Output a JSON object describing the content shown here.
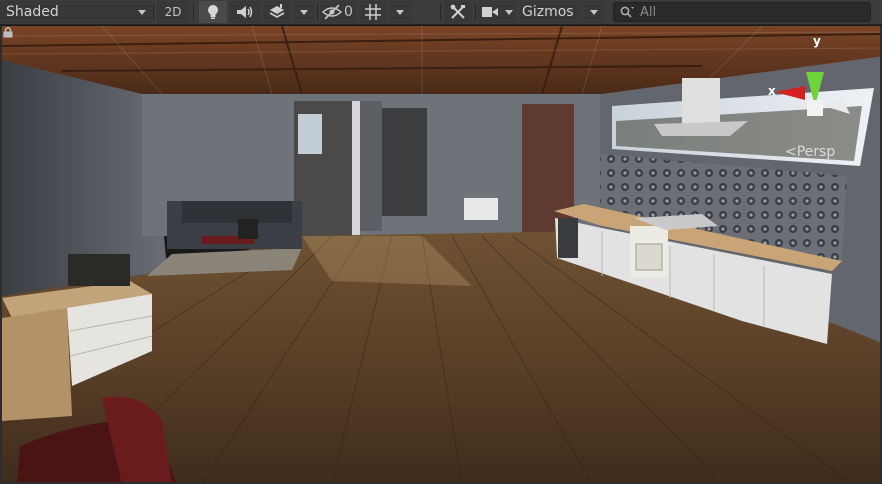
{
  "toolbar": {
    "draw_mode": "Shaded",
    "toggle_2d": "2D",
    "hidden_count": "0",
    "gizmos": "Gizmos",
    "search_placeholder": "All"
  },
  "icons": {
    "lighting": "lightbulb-icon",
    "audio": "speaker-icon",
    "effects": "layers-icon",
    "visibility": "eye-slash-icon",
    "grid": "grid-snap-icon",
    "tools": "tools-icon",
    "camera": "camera-icon",
    "search": "search-icon",
    "lock": "lock-icon"
  },
  "gizmo": {
    "y_axis": "y",
    "x_axis": "x",
    "projection": "<Persp"
  },
  "colors": {
    "toolbar_bg": "#3c3c3c",
    "axis_y": "#6fd33a",
    "axis_x": "#d62020",
    "floor": "#5a4028",
    "ceiling": "#6b3a22"
  }
}
